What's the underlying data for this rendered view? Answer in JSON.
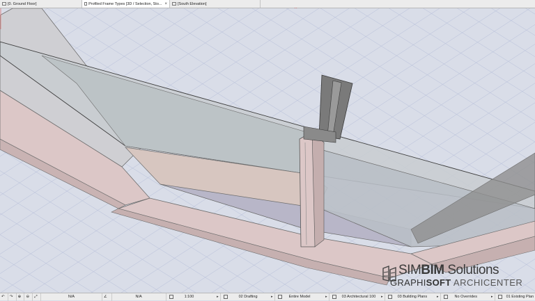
{
  "tabs": [
    {
      "label": "[0. Ground Floor]",
      "active": false
    },
    {
      "label": "Profiled Frame Types [3D / Selection, Sto...",
      "active": true,
      "close": "×"
    },
    {
      "label": "[South Elevation]",
      "active": false
    }
  ],
  "status": {
    "zoom_na_1": "N/A",
    "zoom_na_2": "N/A",
    "scale": "1:100",
    "layer_combo": "02 Drafting",
    "model_view": "Entire Model",
    "pen_set": "03 Architectural 100",
    "mvo": "03 Building Plans",
    "overrides": "No Overrides",
    "renovation": "01 Existing Plan"
  },
  "brand": {
    "name_light": "SIM",
    "name_bold": "BIM",
    "name_rest": " Solutions",
    "sub_light": "GRAPHI",
    "sub_mid": "SOFT",
    "sub_bold": " ARCHICENTER"
  },
  "colors": {
    "grid_bg": "#d9dde8",
    "grid_line": "#b7bfd9",
    "frame_pink": "#dcc7c7",
    "glass": "#c9cdd0",
    "profile_gray": "#7a7a7a"
  }
}
